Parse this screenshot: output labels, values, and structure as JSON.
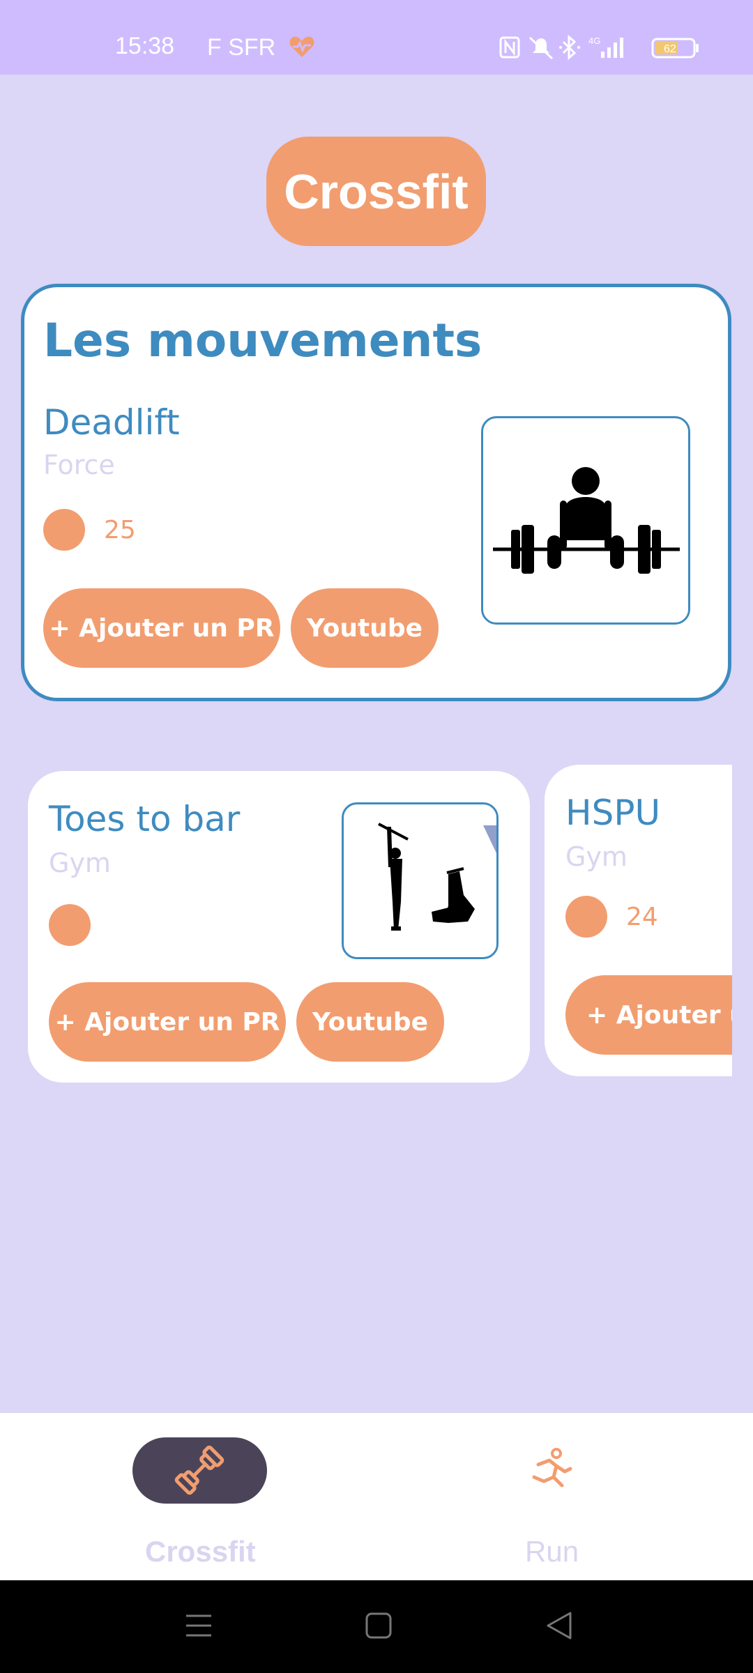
{
  "status_bar": {
    "time": "15:38",
    "carrier": "F SFR",
    "battery": "62",
    "icons": [
      "heart-pulse-icon",
      "nfc-icon",
      "mute-icon",
      "bluetooth-icon",
      "signal-4g-icon",
      "battery-icon"
    ]
  },
  "header": {
    "title": "Crossfit"
  },
  "featured": {
    "section_title": "Les mouvements",
    "name": "Deadlift",
    "category": "Force",
    "pr_value": "25",
    "add_pr_label": "+ Ajouter un PR",
    "youtube_label": "Youtube"
  },
  "cards": [
    {
      "name": "Toes to bar",
      "category": "Gym",
      "pr_value": "",
      "add_pr_label": "+ Ajouter un PR",
      "youtube_label": "Youtube"
    },
    {
      "name": "HSPU",
      "category": "Gym",
      "pr_value": "24",
      "add_pr_label": "+ Ajouter un PR"
    }
  ],
  "bottom_nav": {
    "items": [
      {
        "label": "Crossfit",
        "icon": "dumbbell-icon",
        "selected": true
      },
      {
        "label": "Run",
        "icon": "running-icon",
        "selected": false
      }
    ]
  },
  "colors": {
    "accent": "#f29d6f",
    "primary": "#3e8bc0",
    "background": "#dcd6f7",
    "status_bar": "#cfbcff"
  }
}
